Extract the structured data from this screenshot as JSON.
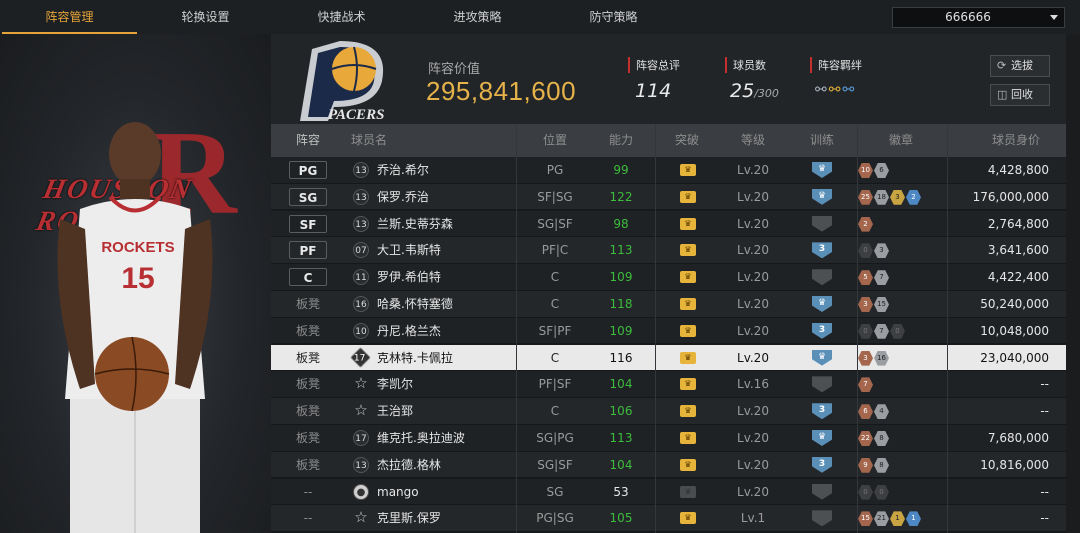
{
  "tabs": [
    {
      "label": "阵容管理",
      "active": true
    },
    {
      "label": "轮换设置"
    },
    {
      "label": "快捷战术"
    },
    {
      "label": "进攻策略"
    },
    {
      "label": "防守策略"
    }
  ],
  "team_select": {
    "value": "666666"
  },
  "player_card": {
    "team_wordmark": "HOUSTON ROCKETS",
    "jersey_text": "ROCKETS",
    "jersey_number": "15"
  },
  "team": {
    "logo_text": "PACERS"
  },
  "lineup_value": {
    "label": "阵容价值",
    "value": "295,841,600"
  },
  "stats": {
    "overall": {
      "label": "阵容总评",
      "value": "114"
    },
    "count": {
      "label": "球员数",
      "value": "25",
      "max": "/300"
    },
    "chemistry": {
      "label": "阵容羁绊",
      "icons": [
        "team-chemistry-icon",
        "team-chemistry-icon",
        "team-chemistry-icon"
      ]
    }
  },
  "buttons": {
    "select": "选拔",
    "recycle": "回收"
  },
  "columns": [
    "阵容",
    "球员名",
    "位置",
    "能力",
    "突破",
    "等级",
    "训练",
    "徽章",
    "球员身价"
  ],
  "rows": [
    {
      "slot": "PG",
      "starter": true,
      "num": "13",
      "icon": "number",
      "name": "乔治.希尔",
      "pos": "PG",
      "ability": "99",
      "green": true,
      "crown": true,
      "level": "Lv.20",
      "train": "shield",
      "badges": [
        [
          "bronze",
          "10"
        ],
        [
          "silver",
          "6"
        ]
      ],
      "salary": "4,428,800"
    },
    {
      "slot": "SG",
      "starter": true,
      "num": "13",
      "icon": "number",
      "name": "保罗.乔治",
      "pos": "SF|SG",
      "ability": "122",
      "green": true,
      "crown": true,
      "level": "Lv.20",
      "train": "shield",
      "badges": [
        [
          "bronze",
          "25"
        ],
        [
          "silver",
          "18"
        ],
        [
          "gold",
          "3"
        ],
        [
          "blue",
          "2"
        ]
      ],
      "salary": "176,000,000"
    },
    {
      "slot": "SF",
      "starter": true,
      "num": "13",
      "icon": "number",
      "name": "兰斯.史蒂芬森",
      "pos": "SG|SF",
      "ability": "98",
      "green": true,
      "crown": true,
      "level": "Lv.20",
      "train": "grey",
      "badges": [
        [
          "bronze",
          "2"
        ]
      ],
      "salary": "2,764,800"
    },
    {
      "slot": "PF",
      "starter": true,
      "num": "07",
      "icon": "number",
      "name": "大卫.韦斯特",
      "pos": "PF|C",
      "ability": "113",
      "green": true,
      "crown": true,
      "level": "Lv.20",
      "train": "3",
      "badges": [
        [
          "dark",
          "0"
        ],
        [
          "silver",
          "3"
        ]
      ],
      "salary": "3,641,600"
    },
    {
      "slot": "C",
      "starter": true,
      "num": "11",
      "icon": "number",
      "name": "罗伊.希伯特",
      "pos": "C",
      "ability": "109",
      "green": true,
      "crown": true,
      "level": "Lv.20",
      "train": "grey",
      "badges": [
        [
          "bronze",
          "5"
        ],
        [
          "silver",
          "7"
        ]
      ],
      "salary": "4,422,400"
    },
    {
      "slot": "板凳",
      "starter": false,
      "num": "16",
      "icon": "number",
      "name": "哈桑.怀特塞德",
      "pos": "C",
      "ability": "118",
      "green": true,
      "crown": true,
      "level": "Lv.20",
      "train": "shield",
      "badges": [
        [
          "bronze",
          "3"
        ],
        [
          "silver",
          "15"
        ]
      ],
      "salary": "50,240,000"
    },
    {
      "slot": "板凳",
      "starter": false,
      "num": "10",
      "icon": "number",
      "name": "丹尼.格兰杰",
      "pos": "SF|PF",
      "ability": "109",
      "green": true,
      "crown": true,
      "level": "Lv.20",
      "train": "3",
      "badges": [
        [
          "dark",
          "0"
        ],
        [
          "silver",
          "7"
        ],
        [
          "dark",
          "0"
        ]
      ],
      "salary": "10,048,000"
    },
    {
      "slot": "板凳",
      "starter": false,
      "num": "17",
      "icon": "diamond",
      "name": "克林特.卡佩拉",
      "pos": "C",
      "ability": "116",
      "green": false,
      "crown": true,
      "level": "Lv.20",
      "train": "shield",
      "badges": [
        [
          "bronze",
          "3"
        ],
        [
          "silver",
          "16"
        ]
      ],
      "salary": "23,040,000",
      "selected": true
    },
    {
      "slot": "板凳",
      "starter": false,
      "num": "",
      "icon": "star",
      "name": "李凯尔",
      "pos": "PF|SF",
      "ability": "104",
      "green": true,
      "crown": true,
      "level": "Lv.16",
      "train": "grey",
      "badges": [
        [
          "bronze",
          "7"
        ]
      ],
      "salary": "--"
    },
    {
      "slot": "板凳",
      "starter": false,
      "num": "",
      "icon": "star",
      "name": "王治郅",
      "pos": "C",
      "ability": "106",
      "green": true,
      "crown": true,
      "level": "Lv.20",
      "train": "3",
      "badges": [
        [
          "bronze",
          "6"
        ],
        [
          "silver",
          "4"
        ]
      ],
      "salary": "--"
    },
    {
      "slot": "板凳",
      "starter": false,
      "num": "17",
      "icon": "number",
      "name": "维克托.奥拉迪波",
      "pos": "SG|PG",
      "ability": "113",
      "green": true,
      "crown": true,
      "level": "Lv.20",
      "train": "shield",
      "badges": [
        [
          "bronze",
          "22"
        ],
        [
          "silver",
          "8"
        ]
      ],
      "salary": "7,680,000"
    },
    {
      "slot": "板凳",
      "starter": false,
      "num": "13",
      "icon": "number",
      "name": "杰拉德.格林",
      "pos": "SG|SF",
      "ability": "104",
      "green": true,
      "crown": true,
      "level": "Lv.20",
      "train": "3",
      "badges": [
        [
          "bronze",
          "9"
        ],
        [
          "silver",
          "8"
        ]
      ],
      "salary": "10,816,000"
    },
    {
      "slot": "--",
      "starter": false,
      "num": "",
      "icon": "person",
      "name": "mango",
      "pos": "SG",
      "ability": "53",
      "green": false,
      "crown": false,
      "level": "Lv.20",
      "train": "grey",
      "badges": [
        [
          "dark",
          "0"
        ],
        [
          "dark",
          "0"
        ]
      ],
      "salary": "--"
    },
    {
      "slot": "--",
      "starter": false,
      "num": "",
      "icon": "star",
      "name": "克里斯.保罗",
      "pos": "PG|SG",
      "ability": "105",
      "green": true,
      "crown": true,
      "level": "Lv.1",
      "train": "grey",
      "badges": [
        [
          "bronze",
          "15"
        ],
        [
          "silver",
          "21"
        ],
        [
          "gold",
          "1"
        ],
        [
          "blue",
          "1"
        ]
      ],
      "salary": "--"
    }
  ]
}
